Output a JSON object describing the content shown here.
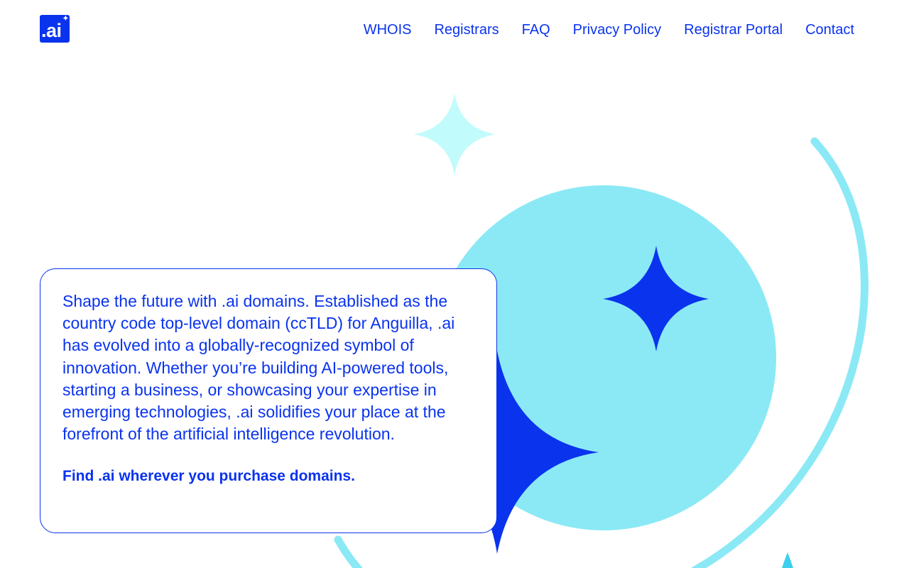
{
  "brand": {
    "logo_text": ".ai",
    "logo_icon": "sparkle-icon",
    "color_primary": "#0a33ee",
    "color_light": "#8be9f5",
    "color_pale": "#c2fbfb"
  },
  "nav": {
    "items": [
      {
        "label": "WHOIS"
      },
      {
        "label": "Registrars"
      },
      {
        "label": "FAQ"
      },
      {
        "label": "Privacy Policy"
      },
      {
        "label": "Registrar Portal"
      },
      {
        "label": "Contact"
      }
    ]
  },
  "hero": {
    "description": "Shape the future with .ai domains. Established as the country code top-level domain (ccTLD) for Anguilla, .ai has evolved into a globally-recognized symbol of innovation. Whether you’re building AI-powered tools, starting a business, or showcasing your expertise in emerging technologies, .ai solidifies your place at the forefront of the artificial intelligence revolution.",
    "cta": "Find .ai wherever you purchase domains."
  }
}
